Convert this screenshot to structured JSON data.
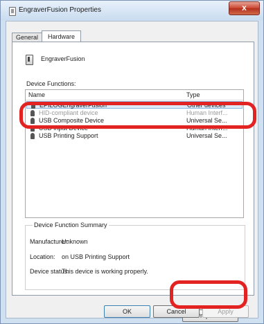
{
  "window": {
    "title": "EngraverFusion Properties",
    "close_glyph": "x"
  },
  "tabs": [
    {
      "label": "General"
    },
    {
      "label": "Hardware"
    }
  ],
  "device": {
    "name": "EngraverFusion"
  },
  "functions": {
    "label": "Device Functions:",
    "columns": {
      "name": "Name",
      "type": "Type"
    },
    "rows": [
      {
        "name": "EPILOGEngraverFusion",
        "type": "Other devices"
      },
      {
        "name": "HID-compliant device",
        "type": "Human Interf..."
      },
      {
        "name": "USB Composite Device",
        "type": "Universal Se..."
      },
      {
        "name": "USB Input Device",
        "type": "Human Interf..."
      },
      {
        "name": "USB Printing Support",
        "type": "Universal Se..."
      }
    ]
  },
  "summary": {
    "legend": "Device Function Summary",
    "manufacturer_label": "Manufacturer:",
    "manufacturer_value": "Unknown",
    "location_label": "Location:",
    "location_value": "on USB Printing Support",
    "status_label": "Device status:",
    "status_value": "This device is working properly."
  },
  "buttons": {
    "properties": "Properties",
    "ok": "OK",
    "cancel": "Cancel",
    "apply": "Apply"
  },
  "colors": {
    "highlight": "#e32222",
    "selection": "#dceaf8",
    "titlebar": "#c9dcf0"
  }
}
